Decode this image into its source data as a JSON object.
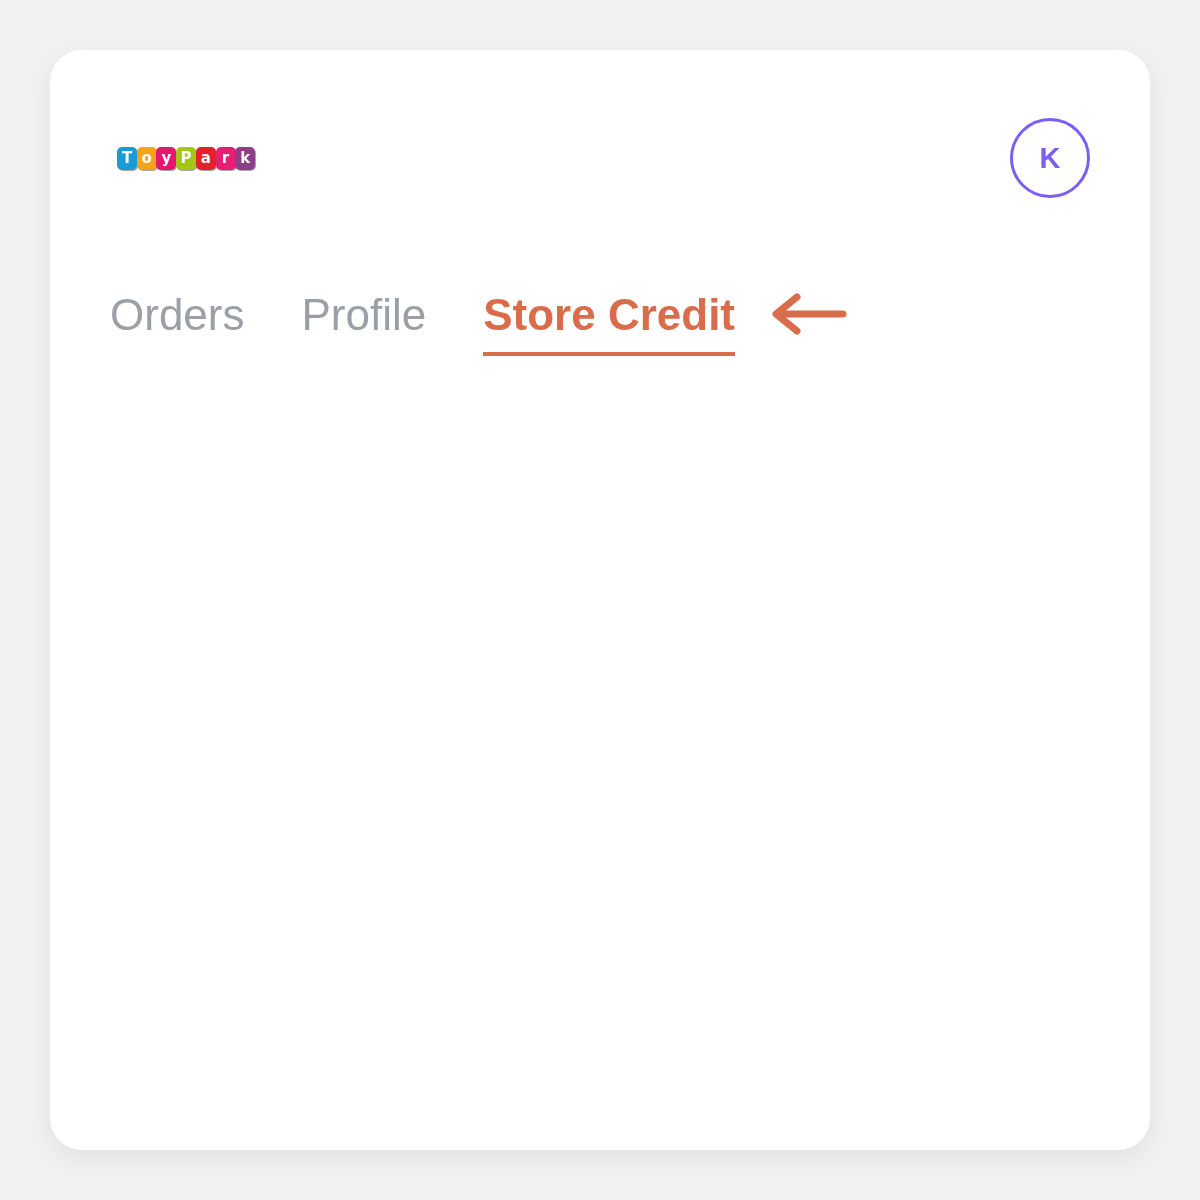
{
  "logo": {
    "tiles": [
      {
        "letter": "T",
        "color": "#1a9ad6"
      },
      {
        "letter": "o",
        "color": "#f6a31b"
      },
      {
        "letter": "y",
        "color": "#e5176e"
      },
      {
        "letter": "P",
        "color": "#a3c617"
      },
      {
        "letter": "a",
        "color": "#e3202b"
      },
      {
        "letter": "r",
        "color": "#e81d74"
      },
      {
        "letter": "k",
        "color": "#8c3e86"
      }
    ]
  },
  "account": {
    "initial": "K"
  },
  "tabs": [
    {
      "label": "Orders",
      "selected": false
    },
    {
      "label": "Profile",
      "selected": false
    },
    {
      "label": "Store Credit",
      "selected": true
    }
  ]
}
